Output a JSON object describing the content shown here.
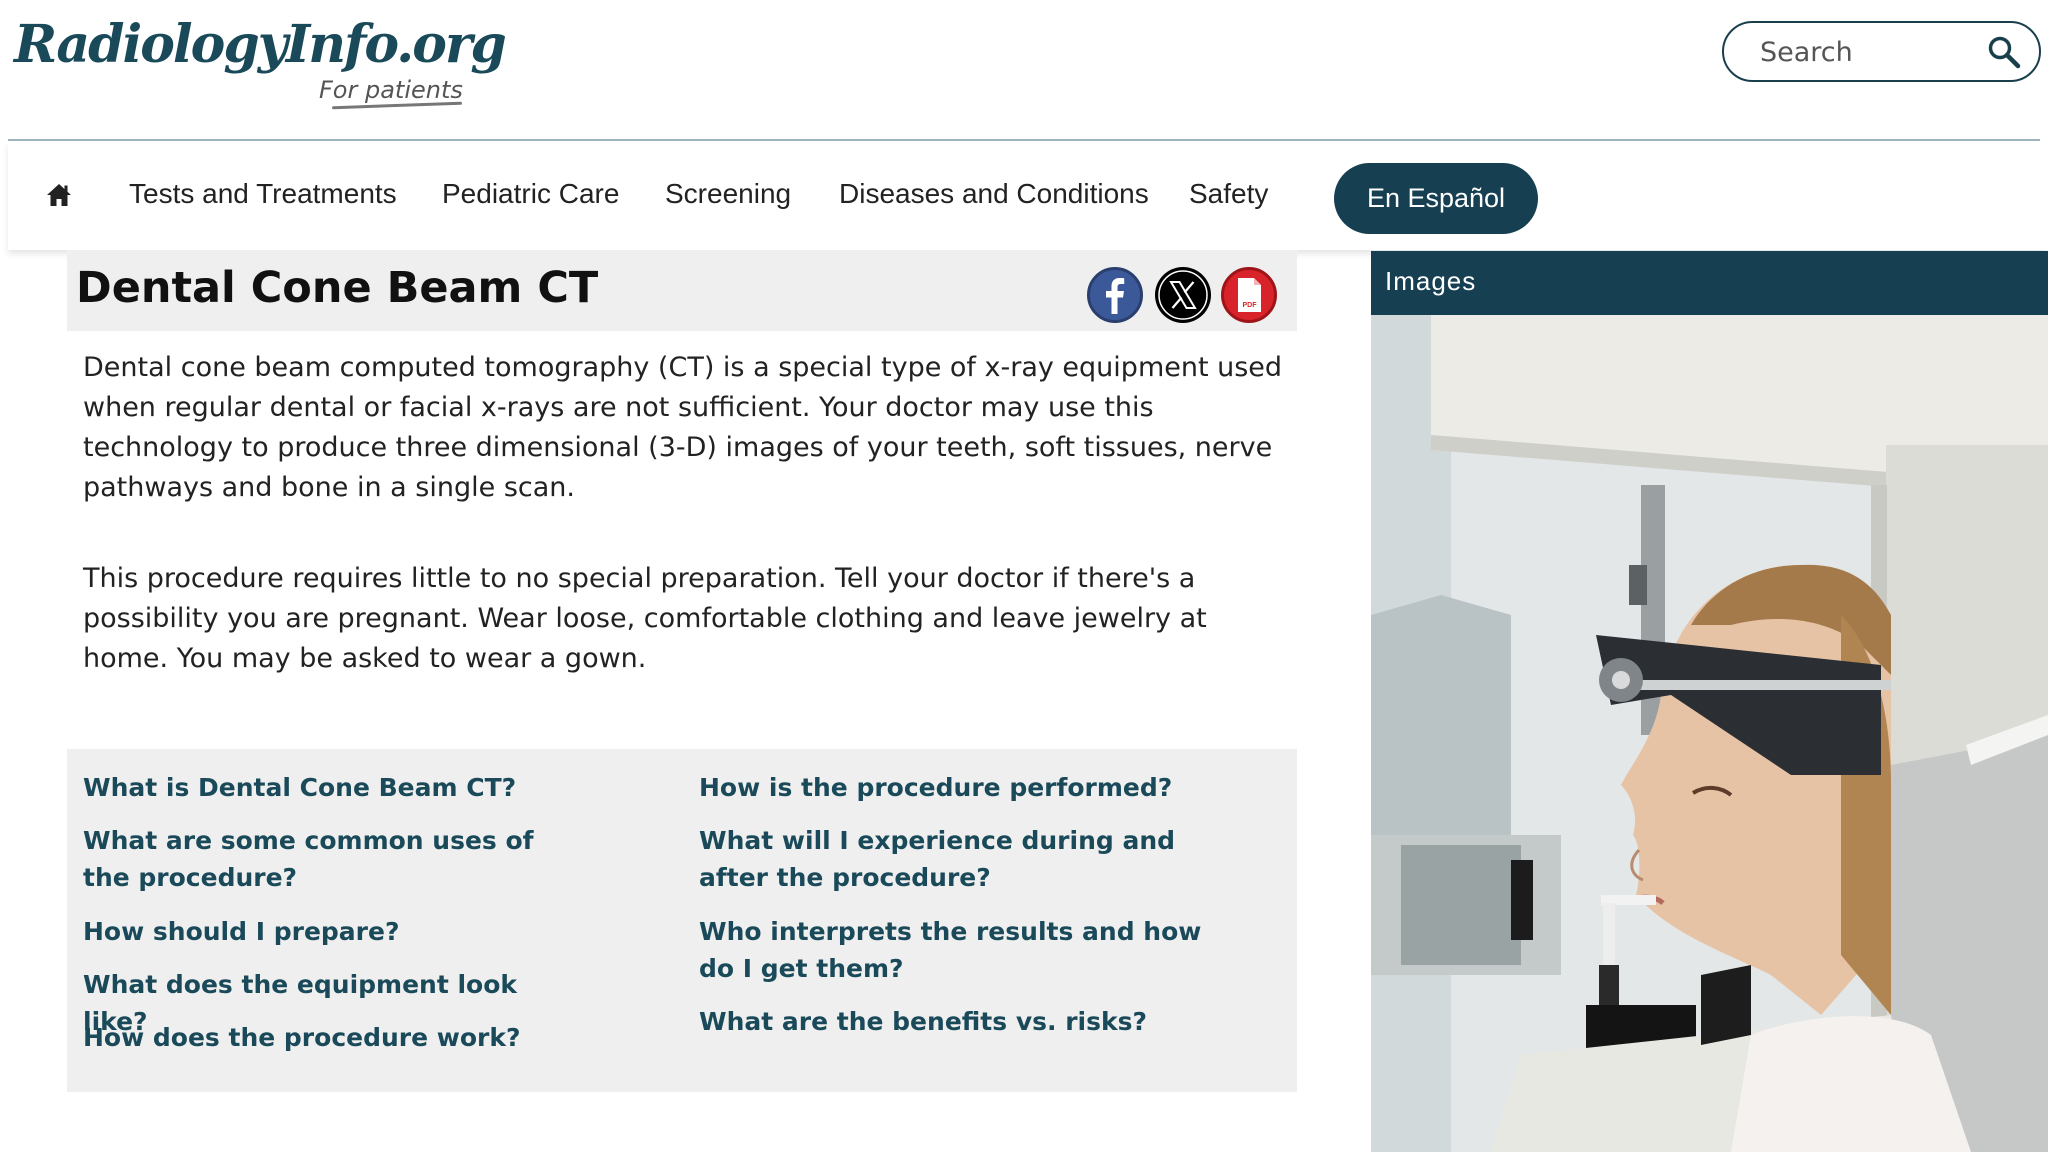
{
  "header": {
    "logo_text": "RadiologyInfo.org",
    "logo_subtext": "For patients",
    "search_placeholder": "Search"
  },
  "nav": {
    "items": [
      {
        "label": "Tests and Treatments"
      },
      {
        "label": "Pediatric Care"
      },
      {
        "label": "Screening"
      },
      {
        "label": "Diseases and Conditions"
      },
      {
        "label": "Safety"
      }
    ],
    "language_button": "En Español"
  },
  "main": {
    "title": "Dental Cone Beam CT",
    "paragraphs": [
      "Dental cone beam computed tomography (CT) is a special type of x-ray equipment used when regular dental or facial x-rays are not sufficient. Your doctor may use this technology to produce three dimensional (3-D) images of your teeth, soft tissues, nerve pathways and bone in a single scan.",
      "This procedure requires little to no special preparation. Tell your doctor if there's a possibility you are pregnant. Wear loose, comfortable clothing and leave jewelry at home. You may be asked to wear a gown."
    ],
    "toc_left": [
      "What is Dental Cone Beam CT?",
      "What are some common uses of the procedure?",
      "How should I prepare?",
      "What does the equipment look like?",
      "How does the procedure work?"
    ],
    "toc_right": [
      "How is the procedure performed?",
      "What will I experience during and after the procedure?",
      "Who interprets the results and how do I get them?",
      "What are the benefits vs. risks?"
    ],
    "pdf_icon_label": "PDF"
  },
  "sidebar": {
    "images_header": "Images"
  },
  "colors": {
    "brand_dark": "#173f52",
    "link": "#1a4a5a",
    "panel_bg": "#efefef",
    "facebook": "#3b5998",
    "pdf_red": "#d8232a"
  },
  "icons": [
    "home-icon",
    "search-icon",
    "facebook-icon",
    "x-icon",
    "pdf-icon"
  ]
}
